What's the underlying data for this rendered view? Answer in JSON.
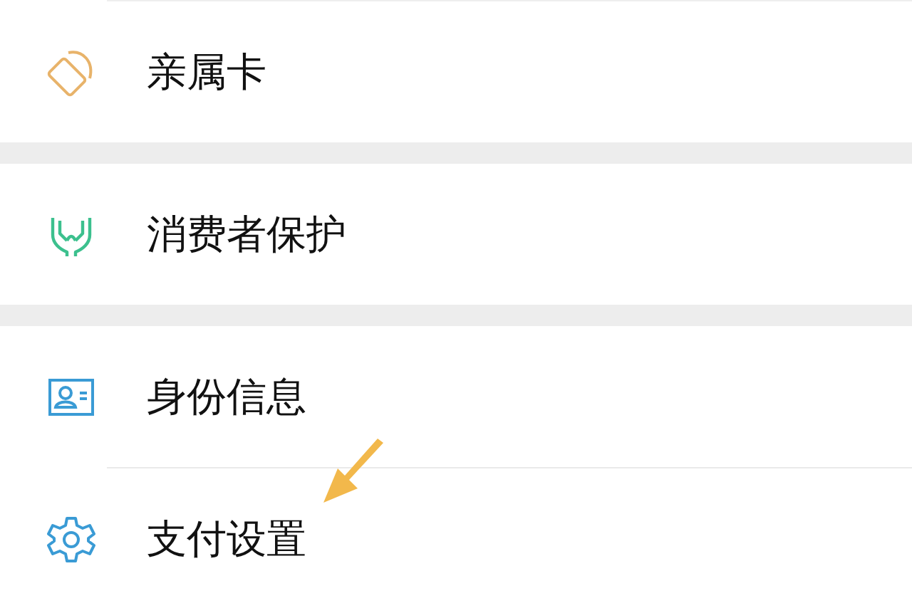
{
  "sections": [
    {
      "items": [
        {
          "label": "亲属卡",
          "kind": "card",
          "color": "#e8b36a"
        }
      ]
    },
    {
      "items": [
        {
          "label": "消费者保护",
          "kind": "hands",
          "color": "#3cc08e"
        }
      ]
    },
    {
      "items": [
        {
          "label": "身份信息",
          "kind": "id",
          "color": "#3a9bd5"
        },
        {
          "label": "支付设置",
          "kind": "gear",
          "color": "#3a9bd5"
        }
      ]
    }
  ]
}
